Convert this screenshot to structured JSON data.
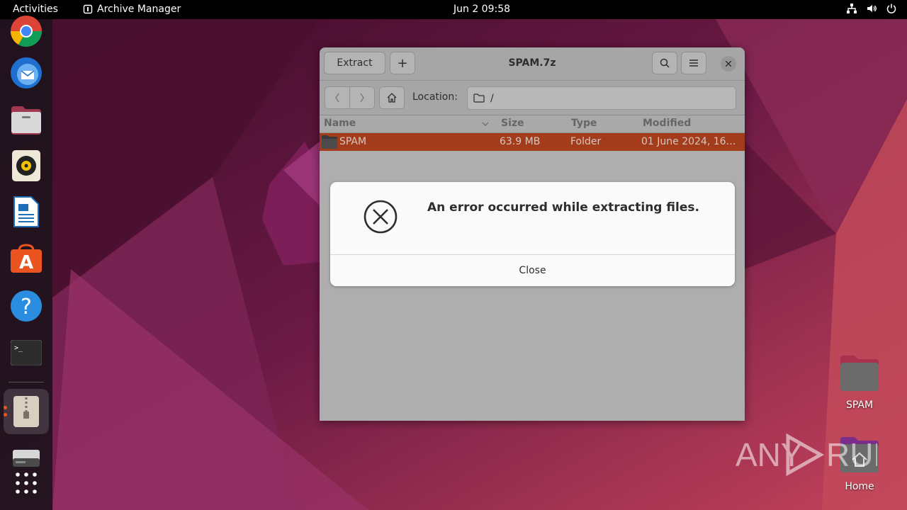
{
  "topbar": {
    "activities": "Activities",
    "app_name": "Archive Manager",
    "clock": "Jun 2  09:58"
  },
  "dock": {
    "items": [
      "chrome",
      "thunderbird",
      "files",
      "rhythmbox",
      "libreoffice-writer",
      "app-center",
      "help",
      "terminal",
      "archive-manager",
      "disk-drive",
      "show-apps"
    ]
  },
  "window": {
    "title": "SPAM.7z",
    "extract_label": "Extract",
    "add_label": "+",
    "location_label": "Location:",
    "location_value": "/",
    "columns": {
      "name": "Name",
      "size": "Size",
      "type": "Type",
      "modified": "Modified"
    },
    "rows": [
      {
        "name": "SPAM",
        "size": "63.9 MB",
        "type": "Folder",
        "modified": "01 June 2024, 16…"
      }
    ]
  },
  "dialog": {
    "message": "An error occurred while extracting files.",
    "close_label": "Close"
  },
  "desktop": {
    "icons": [
      {
        "label": "SPAM"
      },
      {
        "label": "Home"
      }
    ]
  },
  "watermark": {
    "text": "ANY RUN"
  },
  "colors": {
    "accent": "#e95420",
    "selection": "#a23c1a",
    "topbar": "#000000"
  }
}
